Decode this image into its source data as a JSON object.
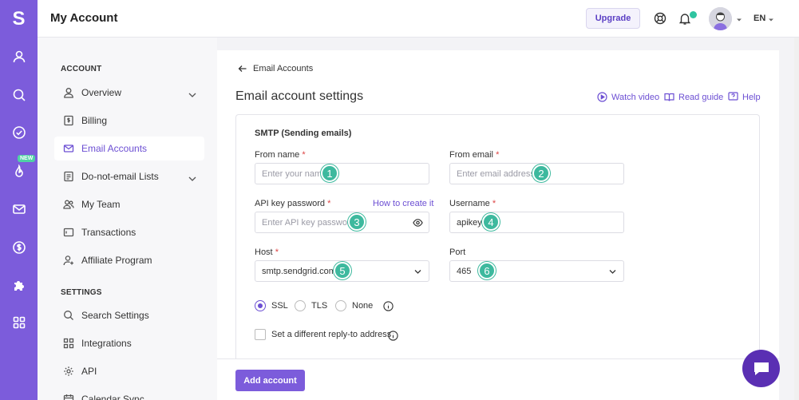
{
  "app": {
    "logo_letter": "S",
    "rail_new_badge": "NEW"
  },
  "header": {
    "title": "My Account",
    "upgrade_label": "Upgrade",
    "language": "EN"
  },
  "nav": {
    "account_heading": "ACCOUNT",
    "settings_heading": "SETTINGS",
    "account_items": [
      {
        "label": "Overview"
      },
      {
        "label": "Billing"
      },
      {
        "label": "Email Accounts"
      },
      {
        "label": "Do-not-email Lists"
      },
      {
        "label": "My Team"
      },
      {
        "label": "Transactions"
      },
      {
        "label": "Affiliate Program"
      }
    ],
    "settings_items": [
      {
        "label": "Search Settings"
      },
      {
        "label": "Integrations"
      },
      {
        "label": "API"
      },
      {
        "label": "Calendar Sync"
      }
    ]
  },
  "page": {
    "back_label": "Email Accounts",
    "title": "Email account settings",
    "watch_video": "Watch video",
    "read_guide": "Read guide",
    "help": "Help"
  },
  "form": {
    "section": "SMTP (Sending emails)",
    "from_name_label": "From name",
    "from_name_placeholder": "Enter your name",
    "from_email_label": "From email",
    "from_email_placeholder": "Enter email address",
    "api_key_label": "API key password",
    "api_key_help": "How to create it",
    "api_key_placeholder": "Enter API key password",
    "username_label": "Username",
    "username_value": "apikey",
    "host_label": "Host",
    "host_value": "smtp.sendgrid.com",
    "port_label": "Port",
    "port_value": "465",
    "required_mark": "*",
    "security_options": [
      "SSL",
      "TLS",
      "None"
    ],
    "security_selected": "SSL",
    "reply_to_label": "Set a different reply-to address",
    "submit_label": "Add account"
  },
  "markers": [
    "1",
    "2",
    "3",
    "4",
    "5",
    "6"
  ],
  "colors": {
    "brand": "#7c5cdb",
    "accent": "#6c4fd3",
    "marker": "#3db99e"
  }
}
